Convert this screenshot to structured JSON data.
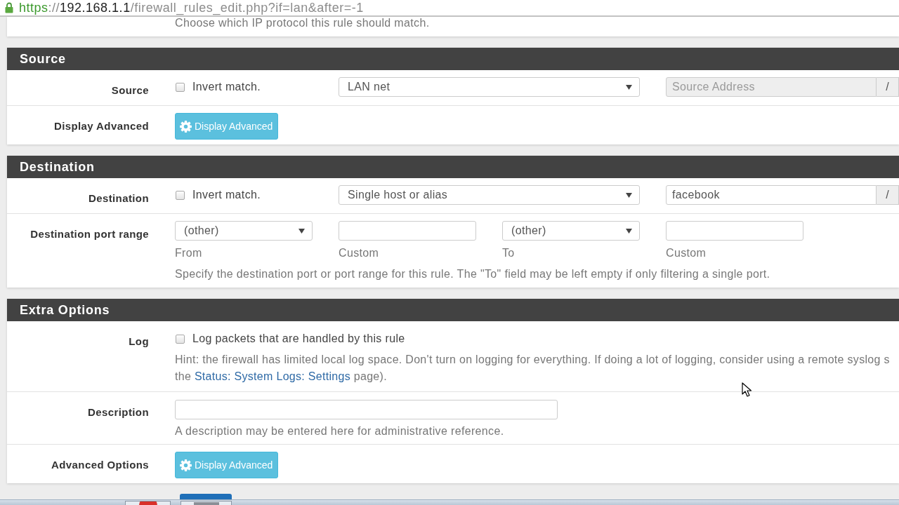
{
  "address_bar": {
    "scheme": "https",
    "separator": "://",
    "host": "192.168.1.1",
    "path": "/firewall_rules_edit.php?if=lan&after=-1"
  },
  "top_panel": {
    "help": "Choose which IP protocol this rule should match."
  },
  "sections": [
    {
      "title": "Source",
      "rows": [
        {
          "kind": "address",
          "label": "Source",
          "invert": {
            "label": "Invert match.",
            "checked": false
          },
          "type_select": {
            "value": "LAN net"
          },
          "address_field": {
            "placeholder": "Source Address",
            "disabled": true
          },
          "mask_addon": "/"
        },
        {
          "kind": "button",
          "label": "Display Advanced",
          "button": "Display Advanced"
        }
      ]
    },
    {
      "title": "Destination",
      "rows": [
        {
          "kind": "address",
          "label": "Destination",
          "invert": {
            "label": "Invert match.",
            "checked": false
          },
          "type_select": {
            "value": "Single host or alias"
          },
          "address_field": {
            "value": "facebook",
            "disabled": false
          },
          "mask_addon": "/"
        },
        {
          "kind": "port_range",
          "label": "Destination port range",
          "fields": [
            {
              "kind": "select",
              "value": "(other)",
              "caption": "From"
            },
            {
              "kind": "input",
              "caption": "Custom"
            },
            {
              "kind": "select",
              "value": "(other)",
              "caption": "To"
            },
            {
              "kind": "input",
              "caption": "Custom"
            }
          ],
          "help": "Specify the destination port or port range for this rule. The \"To\" field may be left empty if only filtering a single port."
        }
      ]
    },
    {
      "title": "Extra Options",
      "rows": [
        {
          "kind": "checkbox",
          "label": "Log",
          "checkbox": {
            "label": "Log packets that are handled by this rule",
            "checked": false
          },
          "hint": {
            "line_1": "Hint: the firewall has limited local log space. Don't turn on logging for everything. If doing a lot of logging, consider using a remote syslog s",
            "before": "the",
            "link": "Status: System Logs: Settings",
            "after": "page)."
          }
        },
        {
          "kind": "text_input",
          "label": "Description",
          "help": "A description may be entered here for administrative reference."
        },
        {
          "kind": "button",
          "label": "Advanced Options",
          "button": "Display Advanced"
        }
      ]
    }
  ]
}
